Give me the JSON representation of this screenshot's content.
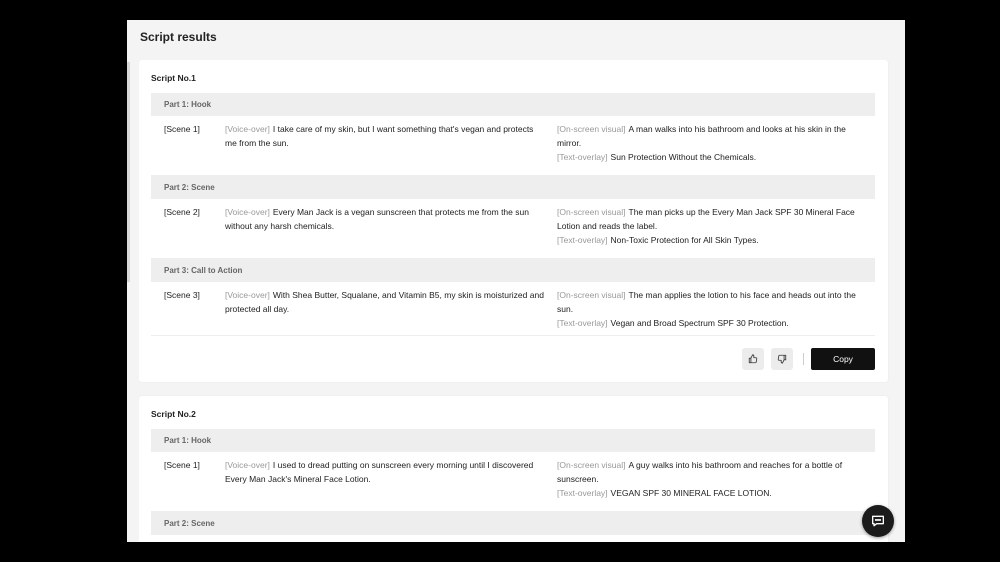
{
  "panel": {
    "title": "Script results"
  },
  "labels": {
    "voice_over": "[Voice-over]",
    "on_screen_visual": "[On-screen visual]",
    "text_overlay": "[Text-overlay]"
  },
  "scripts": [
    {
      "title": "Script No.1",
      "parts": [
        {
          "header": "Part 1: Hook",
          "scene": "[Scene 1]",
          "voice_over": "I take care of my skin, but I want something that's vegan and protects me from the sun.",
          "on_screen_visual": "A man walks into his bathroom and looks at his skin in the mirror.",
          "text_overlay": "Sun Protection Without the Chemicals."
        },
        {
          "header": "Part 2: Scene",
          "scene": "[Scene 2]",
          "voice_over": "Every Man Jack is a vegan sunscreen that protects me from the sun without any harsh chemicals.",
          "on_screen_visual": "The man picks up the Every Man Jack SPF 30 Mineral Face Lotion and reads the label.",
          "text_overlay": "Non-Toxic Protection for All Skin Types."
        },
        {
          "header": "Part 3: Call to Action",
          "scene": "[Scene 3]",
          "voice_over": "With Shea Butter, Squalane, and Vitamin B5, my skin is moisturized and protected all day.",
          "on_screen_visual": "The man applies the lotion to his face and heads out into the sun.",
          "text_overlay": "Vegan and Broad Spectrum SPF 30 Protection."
        }
      ],
      "copy_label": "Copy"
    },
    {
      "title": "Script No.2",
      "parts": [
        {
          "header": "Part 1: Hook",
          "scene": "[Scene 1]",
          "voice_over": "I used to dread putting on sunscreen every morning until I discovered Every Man Jack's Mineral Face Lotion.",
          "on_screen_visual": "A guy walks into his bathroom and reaches for a bottle of sunscreen.",
          "text_overlay": "VEGAN SPF 30 MINERAL FACE LOTION."
        },
        {
          "header": "Part 2: Scene"
        }
      ]
    }
  ]
}
